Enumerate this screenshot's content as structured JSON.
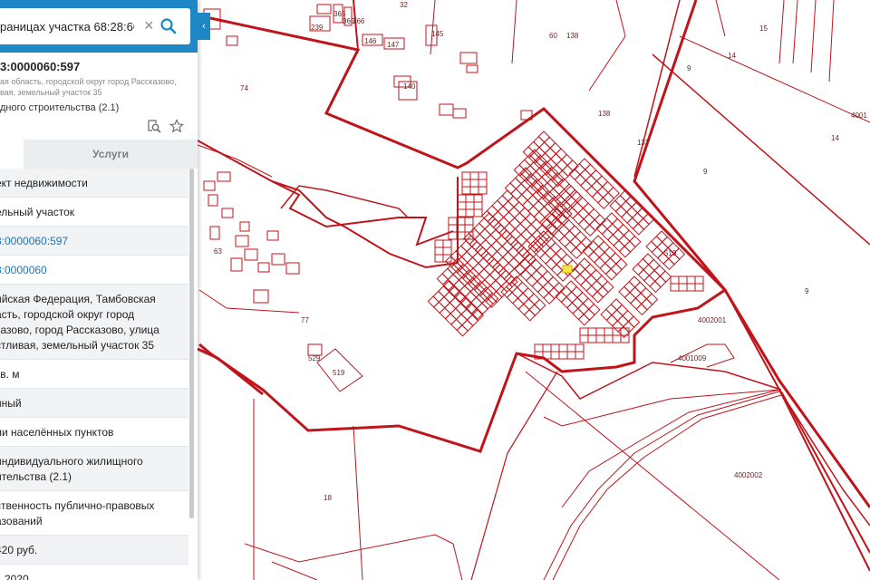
{
  "search": {
    "value": "раницах участка 68:28:60:5",
    "clear_icon": "close-icon",
    "search_icon": "search-icon"
  },
  "parcel": {
    "cad_number": "3:0000060:597",
    "address_line1": "ая область, городской округ город Рассказово,",
    "address_line2": "вая, земельный участок 35",
    "usage": "дного строительства (2.1)"
  },
  "tabs": {
    "services": "Услуги"
  },
  "rows": [
    {
      "text": "ект недвижимости",
      "link": false
    },
    {
      "text": "ельный участок",
      "link": false
    },
    {
      "text": "3:0000060:597",
      "link": true
    },
    {
      "text": "3:0000060",
      "link": true
    },
    {
      "text": "ийская Федерация, Тамбовская\nасть, городской округ город\nказово, город Рассказово, улица\nстливая, земельный участок 35",
      "link": false
    },
    {
      "text": "кв. м",
      "link": false
    },
    {
      "text": "нный",
      "link": false
    },
    {
      "text": "ли населённых пунктов",
      "link": false
    },
    {
      "text": "индивидуального жилищного\nительства (2.1)",
      "link": false
    },
    {
      "text": "ственность публично-правовых\nазований",
      "link": false
    },
    {
      "text": "420 руб.",
      "link": false
    },
    {
      "text": "1.2020",
      "link": false
    }
  ],
  "map": {
    "colors": {
      "boundary": "#c0141b",
      "label": "#6d1f1f",
      "selected": "#f5e642"
    },
    "labels": [
      "32",
      "239",
      "365",
      "365",
      "366",
      "146",
      "147",
      "145",
      "140",
      "138",
      "60",
      "138",
      "14",
      "15",
      "9",
      "74",
      "137",
      "9",
      "14",
      "4001",
      "9",
      "519",
      "63",
      "77",
      "529",
      "519",
      "4002001",
      "4001009",
      "4002002",
      "18"
    ]
  }
}
